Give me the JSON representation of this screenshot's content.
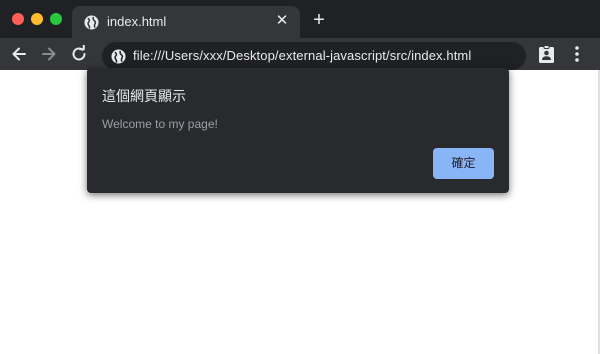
{
  "window": {
    "controls": [
      "close",
      "minimize",
      "maximize"
    ],
    "colors": {
      "close": "#fe5f57",
      "minimize": "#febc2e",
      "maximize": "#28c840"
    }
  },
  "tab": {
    "title": "index.html",
    "favicon": "globe-icon",
    "close_icon": "close-icon"
  },
  "new_tab_icon": "plus-icon",
  "toolbar": {
    "back_icon": "arrow-left-icon",
    "forward_icon": "arrow-right-icon",
    "reload_icon": "reload-icon",
    "url": "file:///Users/xxx/Desktop/external-javascript/src/index.html",
    "url_icon": "globe-icon",
    "extension_icon": "badge-icon",
    "menu_icon": "kebab-menu-icon"
  },
  "dialog": {
    "title": "這個網頁顯示",
    "message": "Welcome to my page!",
    "ok_label": "確定",
    "accent": "#8ab4f8"
  }
}
